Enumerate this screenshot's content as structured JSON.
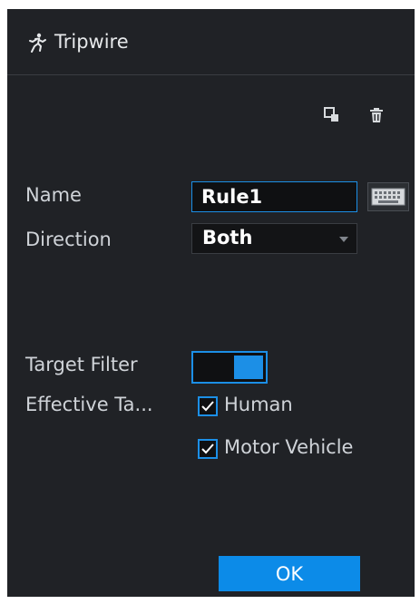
{
  "header": {
    "title": "Tripwire",
    "icon": "running-person-icon"
  },
  "toolbar": {
    "copy_icon": "copy-icon",
    "delete_icon": "trash-icon"
  },
  "form": {
    "name_label": "Name",
    "name_value": "Rule1",
    "keyboard_icon": "keyboard-icon",
    "direction_label": "Direction",
    "direction_value": "Both",
    "target_filter_label": "Target Filter",
    "target_filter_enabled": true,
    "effective_target_label": "Effective Ta...",
    "targets": [
      {
        "label": "Human",
        "checked": true
      },
      {
        "label": "Motor Vehicle",
        "checked": true
      }
    ]
  },
  "footer": {
    "ok_label": "OK"
  },
  "colors": {
    "panel_background": "#202226",
    "accent": "#1c8fe6",
    "button": "#0c8be8"
  }
}
